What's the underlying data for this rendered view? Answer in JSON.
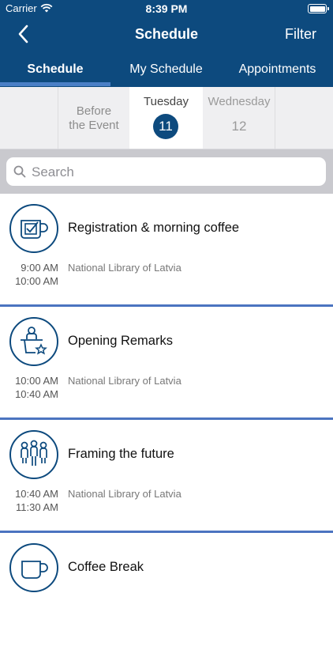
{
  "status": {
    "carrier": "Carrier",
    "time": "8:39 PM"
  },
  "nav": {
    "title": "Schedule",
    "filter": "Filter"
  },
  "tabs": [
    {
      "label": "Schedule",
      "active": true
    },
    {
      "label": "My Schedule",
      "active": false
    },
    {
      "label": "Appointments",
      "active": false
    }
  ],
  "days": {
    "before_line1": "Before",
    "before_line2": "the Event",
    "tuesday_name": "Tuesday",
    "tuesday_num": "11",
    "wednesday_name": "Wednesday",
    "wednesday_num": "12",
    "selected": "Tuesday"
  },
  "search": {
    "placeholder": "Search"
  },
  "sessions": [
    {
      "title": "Registration & morning coffee",
      "start": "9:00 AM",
      "end": "10:00 AM",
      "location": "National Library of Latvia",
      "icon": "coffee-checkbox-icon"
    },
    {
      "title": "Opening Remarks",
      "start": "10:00 AM",
      "end": "10:40 AM",
      "location": "National Library of Latvia",
      "icon": "speaker-podium-icon"
    },
    {
      "title": "Framing the future",
      "start": "10:40 AM",
      "end": "11:30 AM",
      "location": "National Library of Latvia",
      "icon": "people-group-icon"
    },
    {
      "title": "Coffee Break",
      "start": "",
      "end": "",
      "location": "",
      "icon": "coffee-cup-icon"
    }
  ],
  "colors": {
    "header": "#0d4a7e",
    "accent": "#4a7fc6",
    "separator": "#4b74c0",
    "search_bg": "#c9c9ce"
  }
}
